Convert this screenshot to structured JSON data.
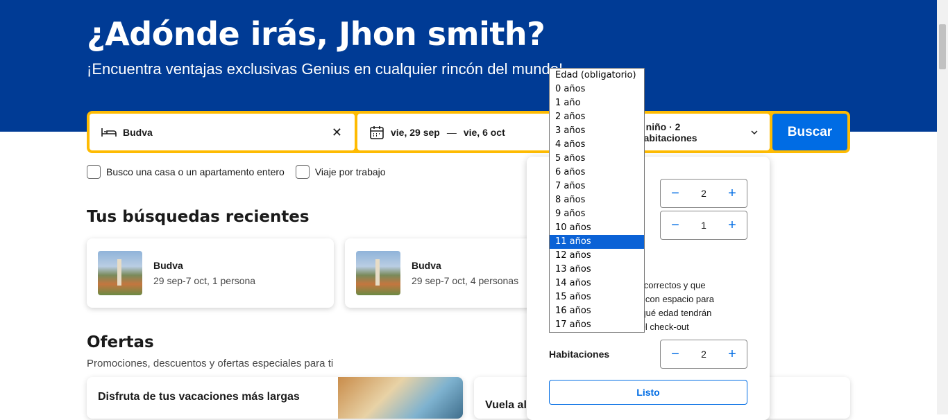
{
  "hero": {
    "title": "¿Adónde irás, Jhon smith?",
    "subtitle": "¡Encuentra ventajas exclusivas Genius en cualquier rincón del mundo!"
  },
  "search": {
    "destination": "Budva",
    "checkin": "vie, 29 sep",
    "dash": "—",
    "checkout": "vie, 6 oct",
    "occupancy": "1 niño · 2 habitaciones",
    "button": "Buscar",
    "colors": {
      "accent": "#febb02",
      "button": "#006ce4",
      "hero": "#003b95"
    }
  },
  "options": {
    "whole_home": "Busco una casa o un apartamento entero",
    "work_trip": "Viaje por trabajo"
  },
  "recent": {
    "heading": "Tus búsquedas recientes",
    "items": [
      {
        "title": "Budva",
        "details": "29 sep-7 oct, 1 persona"
      },
      {
        "title": "Budva",
        "details": "29 sep-7 oct, 4 personas"
      }
    ]
  },
  "offers": {
    "heading": "Ofertas",
    "subtitle": "Promociones, descuentos y ofertas especiales para ti",
    "cards": [
      {
        "title": "Disfruta de tus vacaciones más largas"
      },
      {
        "title": "Vuela al"
      }
    ]
  },
  "occupancy_panel": {
    "adults": "2",
    "children": "1",
    "info_lines": [
      "cios correctos y que",
      "ento con espacio para",
      "oer qué edad tendrán",
      "to del check-out"
    ],
    "rooms_label": "Habitaciones",
    "rooms": "2",
    "done_button": "Listo"
  },
  "age_dropdown": {
    "selected": "11 años",
    "options": [
      "Edad (obligatorio)",
      "0 años",
      "1 año",
      "2 años",
      "3 años",
      "4 años",
      "5 años",
      "6 años",
      "7 años",
      "8 años",
      "9 años",
      "10 años",
      "11 años",
      "12 años",
      "13 años",
      "14 años",
      "15 años",
      "16 años",
      "17 años"
    ]
  }
}
